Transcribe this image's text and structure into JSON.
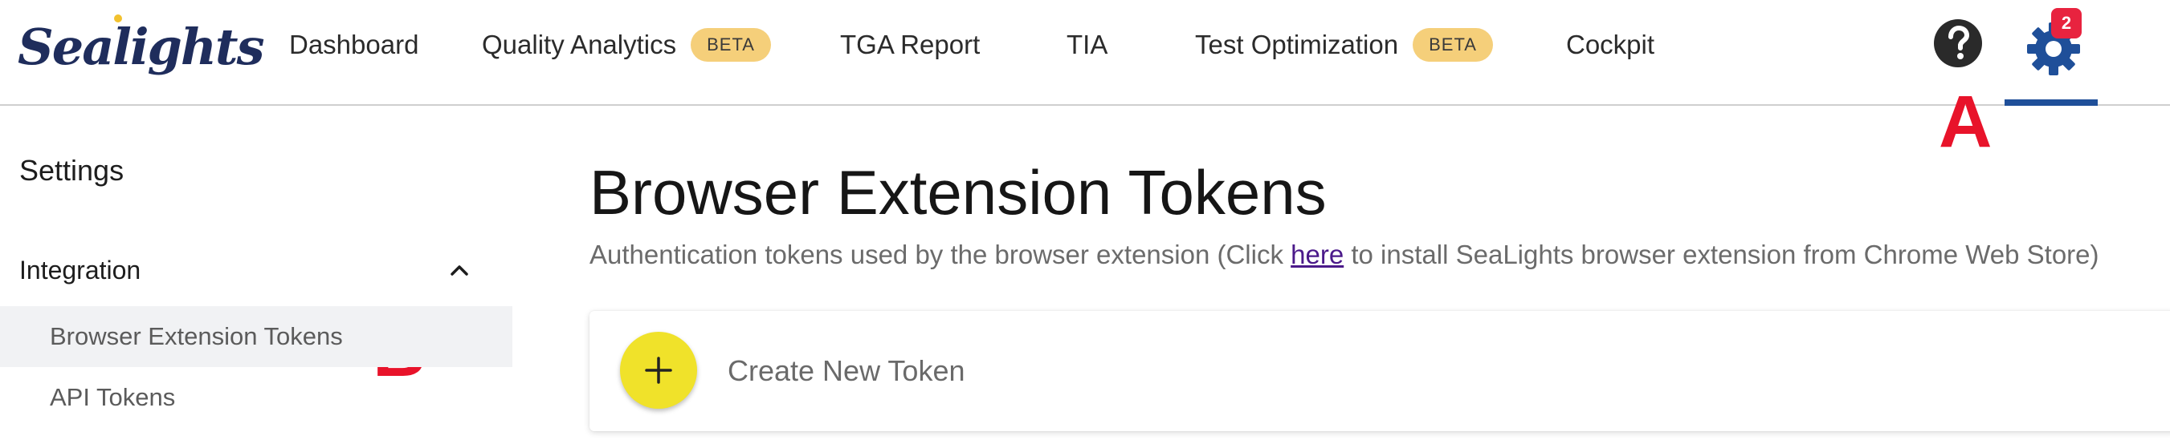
{
  "app": {
    "logo_text": "Sealights"
  },
  "nav": {
    "items": [
      {
        "label": "Dashboard"
      },
      {
        "label": "Quality Analytics",
        "badge": "BETA"
      },
      {
        "label": "TGA Report"
      },
      {
        "label": "TIA"
      },
      {
        "label": "Test Optimization",
        "badge": "BETA"
      },
      {
        "label": "Cockpit"
      }
    ],
    "help_icon": "question-circle-icon",
    "settings_icon": "gear-icon",
    "settings_badge_count": "2"
  },
  "annotations": {
    "marker_a": "A",
    "marker_b": "B",
    "color": "#e8132a"
  },
  "sidebar": {
    "title": "Settings",
    "group_label": "Integration",
    "group_icon": "chevron-up-icon",
    "items": [
      {
        "label": "Browser Extension Tokens",
        "active": true
      },
      {
        "label": "API Tokens",
        "active": false
      }
    ]
  },
  "main": {
    "title": "Browser Extension Tokens",
    "subtitle_before": "Authentication tokens used by the browser extension (Click ",
    "subtitle_link": "here",
    "subtitle_after": " to install SeaLights browser extension from Chrome Web Store)",
    "create_label": "Create New Token",
    "create_icon": "plus-icon"
  },
  "colors": {
    "brand_navy": "#1f2d5c",
    "accent_blue": "#1f4f99",
    "beta_badge": "#f5cf7a",
    "add_button": "#f0e22a",
    "notification": "#e8233f"
  }
}
